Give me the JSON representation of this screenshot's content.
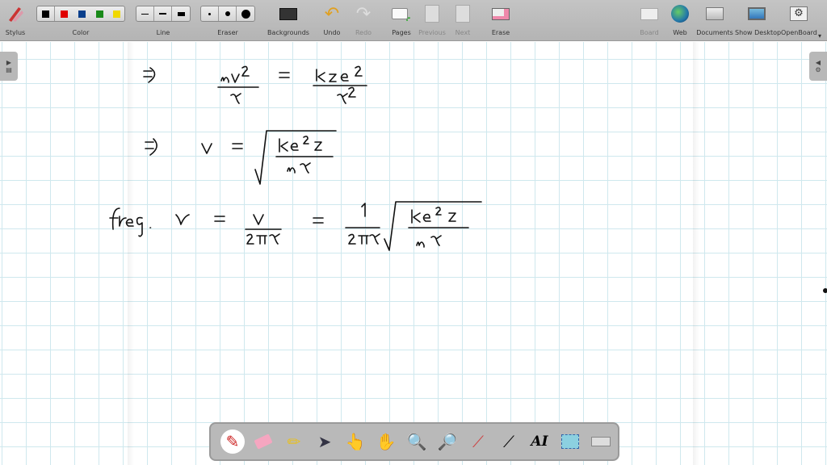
{
  "toolbar": {
    "stylus": "Stylus",
    "color": "Color",
    "line": "Line",
    "eraser": "Eraser",
    "backgrounds": "Backgrounds",
    "undo": "Undo",
    "redo": "Redo",
    "pages": "Pages",
    "previous": "Previous",
    "next": "Next",
    "erase": "Erase",
    "board": "Board",
    "web": "Web",
    "documents": "Documents",
    "show_desktop": "Show Desktop",
    "openboard": "OpenBoard"
  },
  "colors": [
    "#000000",
    "#e00000",
    "#0a3f8c",
    "#1a8a1a",
    "#f0d800"
  ],
  "dock": [
    "pen-tool",
    "eraser-tool",
    "highlighter-tool",
    "select-tool",
    "interact-tool",
    "hand-tool",
    "zoom-in-tool",
    "zoom-out-tool",
    "laser-pointer-tool",
    "line-tool",
    "text-tool",
    "capture-tool",
    "keyboard-tool"
  ]
}
